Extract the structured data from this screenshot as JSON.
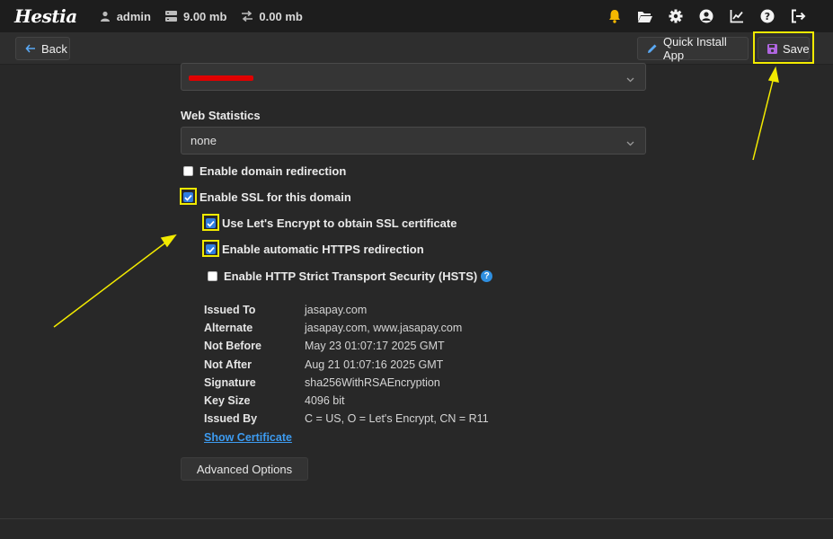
{
  "topbar": {
    "logo": "Hestia",
    "user": "admin",
    "disk": "9.00 mb",
    "bandwidth": "0.00 mb",
    "icons": [
      "bell-icon",
      "folder-icon",
      "gear-icon",
      "user-circle-icon",
      "chart-icon",
      "help-icon",
      "logout-icon"
    ],
    "bell_color": "#f5b800"
  },
  "toolbar": {
    "back_label": "Back",
    "quick_install_label": "Quick Install App",
    "save_label": "Save",
    "save_icon_color": "#b066e0"
  },
  "form": {
    "web_statistics_label": "Web Statistics",
    "web_statistics_value": "none",
    "checkboxes": {
      "domain_redirection": {
        "label": "Enable domain redirection",
        "checked": false
      },
      "ssl": {
        "label": "Enable SSL for this domain",
        "checked": true
      },
      "letsencrypt": {
        "label": "Use Let's Encrypt to obtain SSL certificate",
        "checked": true
      },
      "https_redirect": {
        "label": "Enable automatic HTTPS redirection",
        "checked": true
      },
      "hsts": {
        "label": "Enable HTTP Strict Transport Security (HSTS)",
        "checked": false
      }
    },
    "help_glyph": "?"
  },
  "certificate": {
    "issued_to": {
      "label": "Issued To",
      "value": "jasapay.com"
    },
    "alternate": {
      "label": "Alternate",
      "value": "jasapay.com, www.jasapay.com"
    },
    "not_before": {
      "label": "Not Before",
      "value": "May 23 01:07:17 2025 GMT"
    },
    "not_after": {
      "label": "Not After",
      "value": "Aug 21 01:07:16 2025 GMT"
    },
    "signature": {
      "label": "Signature",
      "value": "sha256WithRSAEncryption"
    },
    "key_size": {
      "label": "Key Size",
      "value": "4096 bit"
    },
    "issued_by": {
      "label": "Issued By",
      "value": "C = US, O = Let's Encrypt, CN = R11"
    },
    "show_label": "Show Certificate"
  },
  "advanced_label": "Advanced Options",
  "colors": {
    "highlight": "#f2ea00",
    "link": "#3d9bf0",
    "checkbox": "#2f7de1"
  }
}
